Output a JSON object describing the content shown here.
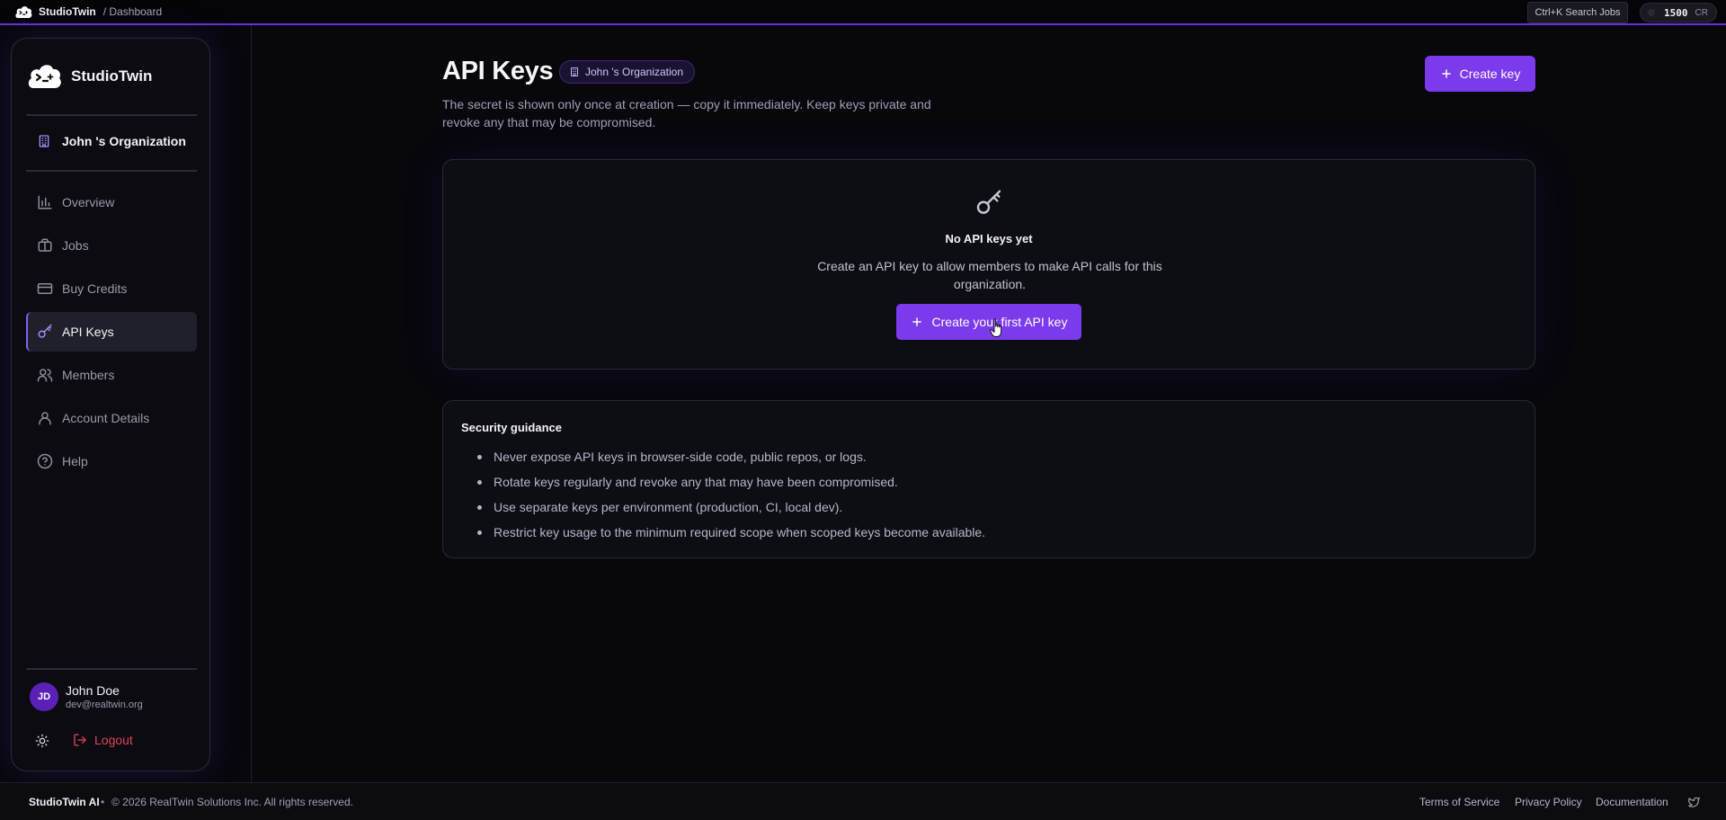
{
  "topbar": {
    "brand": "StudioTwin",
    "breadcrumb": "/ Dashboard",
    "search_label": "Ctrl+K Search Jobs",
    "credits_amount": "1500",
    "credits_unit": "CR"
  },
  "sidebar": {
    "logo_text": "StudioTwin",
    "organization": "John 's Organization",
    "items": [
      {
        "label": "Overview",
        "icon": "bar-chart-icon"
      },
      {
        "label": "Jobs",
        "icon": "briefcase-icon"
      },
      {
        "label": "Buy Credits",
        "icon": "credit-card-icon"
      },
      {
        "label": "API Keys",
        "icon": "key-icon",
        "active": true
      },
      {
        "label": "Members",
        "icon": "users-icon"
      },
      {
        "label": "Account Details",
        "icon": "user-icon"
      },
      {
        "label": "Help",
        "icon": "help-circle-icon"
      }
    ],
    "user": {
      "initials": "JD",
      "name": "John Doe",
      "email": "dev@realtwin.org"
    },
    "logout_label": "Logout"
  },
  "main": {
    "title": "API Keys",
    "org_badge": "John 's Organization",
    "subtitle": "The secret is shown only once at creation — copy it immediately. Keep keys private and revoke any that may be compromised.",
    "create_key_label": "Create key",
    "empty_state": {
      "title": "No API keys yet",
      "description": "Create an API key to allow members to make API calls for this organization.",
      "button_label": "Create your first API key"
    },
    "guidance": {
      "title": "Security guidance",
      "items": [
        "Never expose API keys in browser-side code, public repos, or logs.",
        "Rotate keys regularly and revoke any that may have been compromised.",
        "Use separate keys per environment (production, CI, local dev).",
        "Restrict key usage to the minimum required scope when scoped keys become available."
      ]
    }
  },
  "footer": {
    "brand": "StudioTwin AI",
    "separator": "•",
    "copyright": "© 2026 RealTwin Solutions Inc. All rights reserved.",
    "links": [
      "Terms of Service",
      "Privacy Policy",
      "Documentation"
    ]
  },
  "colors": {
    "accent": "#7c3aed",
    "background": "#07070c",
    "danger": "#e0465a"
  }
}
